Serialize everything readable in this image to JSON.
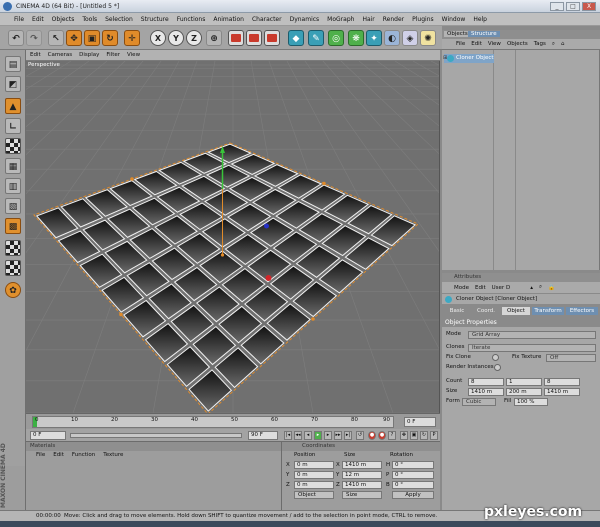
{
  "window": {
    "title": "CINEMA 4D (64 Bit) - [Untitled 5 *]",
    "buttons": [
      "_",
      "□",
      "X"
    ]
  },
  "menubar": [
    "File",
    "Edit",
    "Objects",
    "Tools",
    "Selection",
    "Structure",
    "Functions",
    "Animation",
    "Character",
    "Dynamics",
    "MoGraph",
    "Hair",
    "Render",
    "Plugins",
    "Window",
    "Help"
  ],
  "toolbar": {
    "axis_x": "X",
    "axis_y": "Y",
    "axis_z": "Z"
  },
  "viewport": {
    "menu": [
      "Edit",
      "Cameras",
      "Display",
      "Filter",
      "View"
    ],
    "label": "Perspective"
  },
  "timeline": {
    "ticks": [
      "0",
      "10",
      "20",
      "30",
      "40",
      "50",
      "60",
      "70",
      "80",
      "90"
    ],
    "end_field": "0 F"
  },
  "transport": {
    "start_field": "0 F",
    "end_field": "90 F"
  },
  "materials": {
    "title": "Materials",
    "menu": [
      "File",
      "Edit",
      "Function",
      "Texture"
    ]
  },
  "coordinates": {
    "title": "Coordinates",
    "columns": [
      "Position",
      "Size",
      "Rotation"
    ],
    "rows": [
      {
        "axis": "X",
        "pos": "0 m",
        "size": "1410 m",
        "rot_label": "H",
        "rot": "0 °"
      },
      {
        "axis": "Y",
        "pos": "0 m",
        "size": "12 m",
        "rot_label": "P",
        "rot": "0 °"
      },
      {
        "axis": "Z",
        "pos": "0 m",
        "size": "1410 m",
        "rot_label": "B",
        "rot": "0 °"
      }
    ],
    "mode_select": "Object",
    "size_select": "Size",
    "apply": "Apply"
  },
  "branding": "MAXON CINEMA 4D",
  "status": {
    "time": "00:00:00",
    "message": "Move: Click and drag to move elements. Hold down SHIFT to quantize movement / add to the selection in point mode, CTRL to remove."
  },
  "objects_panel": {
    "tabs": [
      "Objects",
      "Structure"
    ],
    "menu": [
      "File",
      "Edit",
      "View",
      "Objects",
      "Tags"
    ],
    "items": [
      {
        "name": "Cloner Object"
      }
    ]
  },
  "attributes_panel": {
    "title": "Attributes",
    "menu": [
      "Mode",
      "Edit",
      "User D"
    ],
    "object_title": "Cloner Object [Cloner Object]",
    "tabs": [
      "Basic",
      "Coord.",
      "Object",
      "Transform",
      "Effectors"
    ],
    "section": "Object Properties",
    "mode_label": "Mode",
    "mode_value": "Grid Array",
    "clones_label": "Clones",
    "clones_value": "Iterate",
    "fix_clone_label": "Fix Clone",
    "fix_texture_label": "Fix Texture",
    "fix_texture_value": "Off",
    "render_instances_label": "Render Instances",
    "count_label": "Count",
    "count_values": [
      "8",
      "1",
      "8"
    ],
    "size_label": "Size",
    "size_values": [
      "1410 m",
      "200 m",
      "1410 m"
    ],
    "form_label": "Form",
    "form_value": "Cubic",
    "fill_label": "Fill",
    "fill_value": "100 %"
  },
  "watermark": "pxleyes.com",
  "colors": {
    "accent_orange": "#e08b2a",
    "selection_blue": "#7fa4c8",
    "viewport_bg": "#707070"
  }
}
